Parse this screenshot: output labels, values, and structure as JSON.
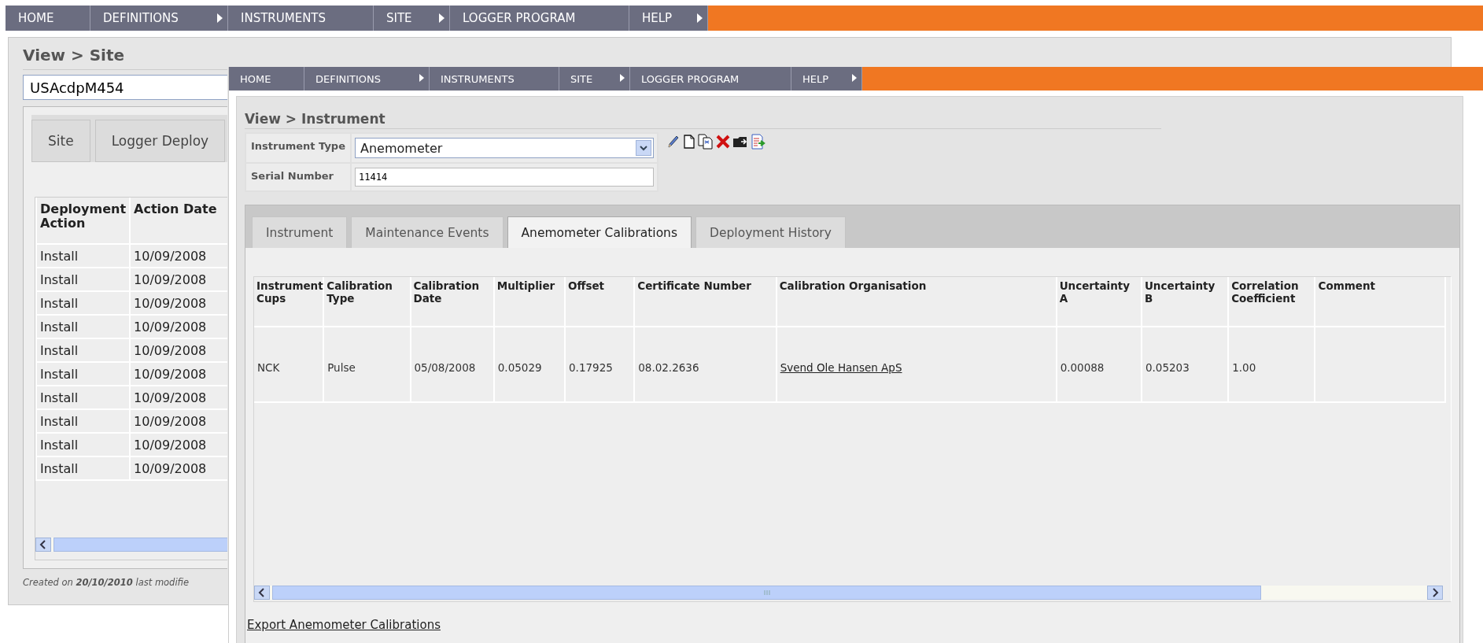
{
  "back_window": {
    "nav": [
      {
        "label": "HOME",
        "submenu": false
      },
      {
        "label": "DEFINITIONS",
        "submenu": true
      },
      {
        "label": "INSTRUMENTS",
        "submenu": false
      },
      {
        "label": "SITE",
        "submenu": true
      },
      {
        "label": "LOGGER PROGRAM",
        "submenu": false
      },
      {
        "label": "HELP",
        "submenu": true
      }
    ],
    "heading": "View > Site",
    "site_field": {
      "value": "USAcdpM454"
    },
    "tabs": [
      {
        "label": "Site",
        "selected": false
      },
      {
        "label": "Logger Deploy",
        "selected": false
      }
    ],
    "table": {
      "columns": [
        "Deployment Action",
        "Action Date"
      ],
      "rows": [
        [
          "Install",
          "10/09/2008"
        ],
        [
          "Install",
          "10/09/2008"
        ],
        [
          "Install",
          "10/09/2008"
        ],
        [
          "Install",
          "10/09/2008"
        ],
        [
          "Install",
          "10/09/2008"
        ],
        [
          "Install",
          "10/09/2008"
        ],
        [
          "Install",
          "10/09/2008"
        ],
        [
          "Install",
          "10/09/2008"
        ],
        [
          "Install",
          "10/09/2008"
        ],
        [
          "Install",
          "10/09/2008"
        ]
      ]
    },
    "footer": "Created on **20/10/2010** last modifie"
  },
  "front_window": {
    "nav": [
      {
        "label": "HOME",
        "submenu": false
      },
      {
        "label": "DEFINITIONS",
        "submenu": true
      },
      {
        "label": "INSTRUMENTS",
        "submenu": false
      },
      {
        "label": "SITE",
        "submenu": true
      },
      {
        "label": "LOGGER PROGRAM",
        "submenu": false
      },
      {
        "label": "HELP",
        "submenu": true
      }
    ],
    "heading": "View > Instrument",
    "instrument_type": {
      "label": "Instrument Type",
      "value": "Anemometer"
    },
    "serial_number": {
      "label": "Serial Number",
      "value": "11414"
    },
    "tabs": [
      {
        "label": "Instrument",
        "selected": false
      },
      {
        "label": "Maintenance Events",
        "selected": false
      },
      {
        "label": "Anemometer Calibrations",
        "selected": true
      },
      {
        "label": "Deployment History",
        "selected": false
      }
    ],
    "table": {
      "columns": [
        {
          "label": "Instrument Cups",
          "kind": "text"
        },
        {
          "label": "Calibration Type",
          "kind": "text"
        },
        {
          "label": "Calibration Date",
          "kind": "text"
        },
        {
          "label": "Multiplier",
          "kind": "text"
        },
        {
          "label": "Offset",
          "kind": "text"
        },
        {
          "label": "Certificate Number",
          "kind": "text"
        },
        {
          "label": "Calibration Organisation",
          "kind": "link"
        },
        {
          "label": "Uncertainty A",
          "kind": "text"
        },
        {
          "label": "Uncertainty B",
          "kind": "text"
        },
        {
          "label": "Correlation Coefficient",
          "kind": "text"
        },
        {
          "label": "Comment"
        }
      ],
      "rows": [
        [
          "NCK",
          "Pulse",
          "05/08/2008",
          "0.05029",
          "0.17925",
          "08.02.2636",
          "Svend Ole Hansen ApS",
          "0.00088",
          "0.05203",
          "1.00"
        ]
      ]
    },
    "export_link": "Export Anemometer Calibrations"
  }
}
